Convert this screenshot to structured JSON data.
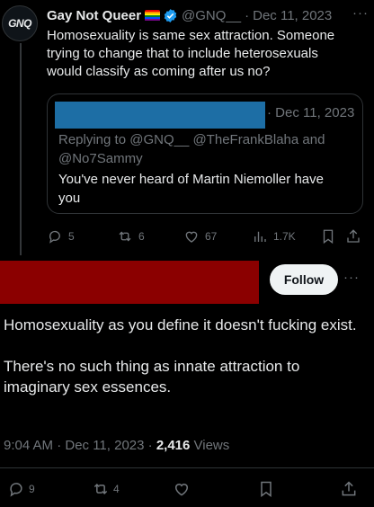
{
  "tweet1": {
    "display_name": "Gay Not Queer",
    "avatar_text": "GNQ",
    "handle": "@GNQ__",
    "separator": "·",
    "date": "Dec 11, 2023",
    "more": "···",
    "text": "Homosexuality is same sex attraction. Someone trying to change that to include heterosexuals would classify as coming after us no?",
    "quote": {
      "date": "· Dec 11, 2023",
      "replying": "Replying to @GNQ__ @TheFrankBlaha and @No7Sammy",
      "text": "You've never heard of Martin Niemoller have you"
    },
    "actions": {
      "replies": "5",
      "reposts": "6",
      "likes": "67",
      "views": "1.7K"
    }
  },
  "tweet2": {
    "follow_label": "Follow",
    "more": "···",
    "paragraph1": "Homosexuality as you define it doesn't fucking exist.",
    "paragraph2": "There's no such thing as innate attraction to imaginary sex essences.",
    "time": "9:04 AM · Dec 11, 2023 · ",
    "views_count": "2,416",
    "views_label": " Views",
    "actions": {
      "replies": "9",
      "reposts": "4"
    }
  },
  "colors": {
    "background": "#000000",
    "text": "#e7e9ea",
    "muted": "#71767b",
    "verified": "#1d9bf0",
    "redaction_blue": "#1d6ea5",
    "redaction_red": "#8b0000"
  },
  "icons": [
    "verified-badge-icon",
    "rainbow-flag-icon",
    "reply-icon",
    "repost-icon",
    "like-icon",
    "views-icon",
    "bookmark-icon",
    "share-icon",
    "more-icon"
  ]
}
